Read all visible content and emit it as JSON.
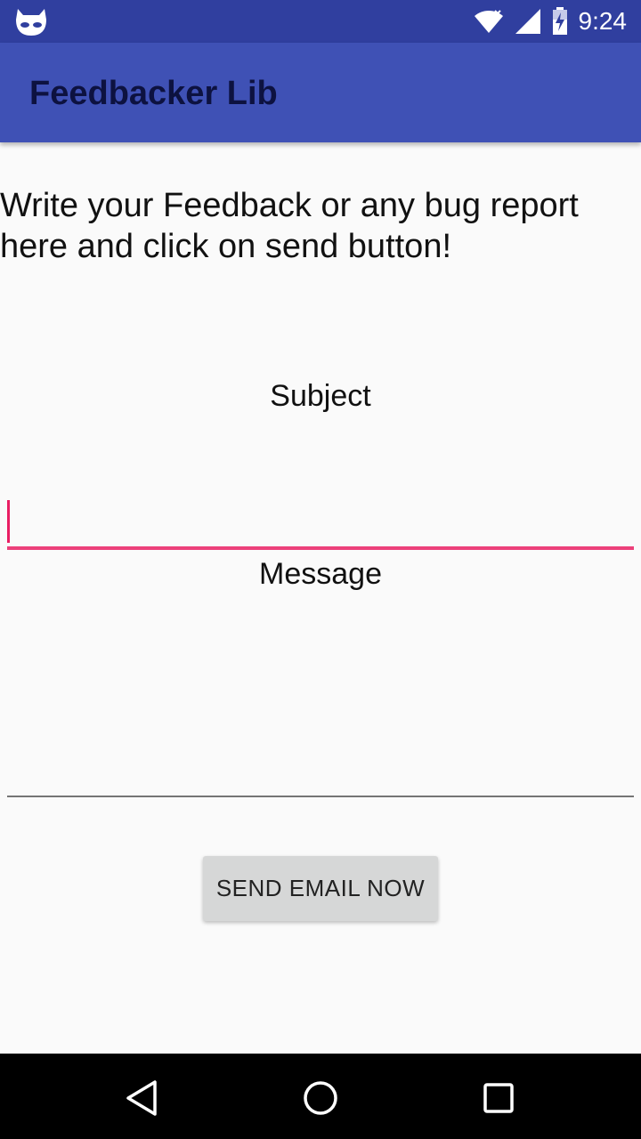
{
  "status_bar": {
    "time": "9:24",
    "icons": [
      "cyanogenmod-logo-icon",
      "wifi-icon",
      "cellular-signal-icon",
      "battery-charging-icon"
    ]
  },
  "app_bar": {
    "title": "Feedbacker Lib"
  },
  "main": {
    "intro_text": "Write your Feedback or any bug report here and click on send button!",
    "subject_label": "Subject",
    "subject_value": "",
    "message_label": "Message",
    "message_value": "",
    "send_button_label": "SEND EMAIL NOW"
  },
  "nav_bar": {
    "icons": [
      "back-icon",
      "home-icon",
      "recents-icon"
    ]
  },
  "colors": {
    "status_bar": "#303f9f",
    "app_bar": "#3f51b5",
    "accent": "#e91e63",
    "background": "#fafafa"
  }
}
